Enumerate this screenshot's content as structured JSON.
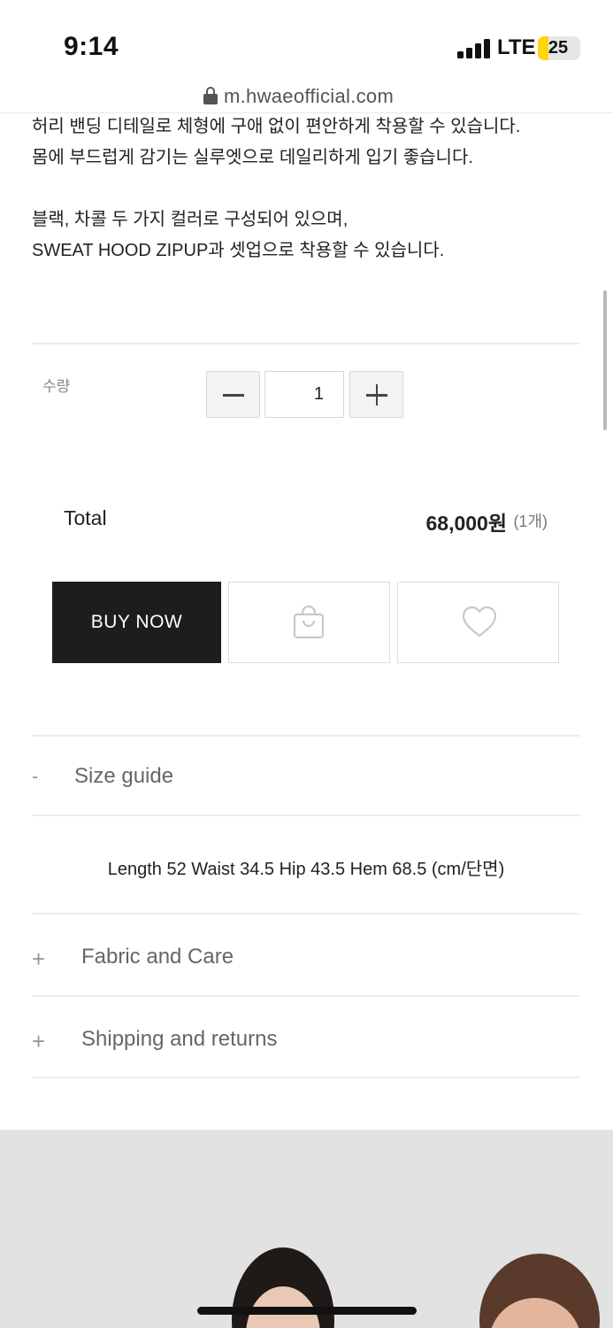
{
  "status_bar": {
    "time": "9:14",
    "network": "LTE",
    "battery": "25",
    "battery_level": 0.25
  },
  "browser": {
    "url": "m.hwaeofficial.com"
  },
  "description": {
    "line1": "허리 밴딩 디테일로 체형에 구애 없이 편안하게 착용할 수 있습니다.",
    "line2": "몸에 부드럽게 감기는 실루엣으로 데일리하게 입기 좋습니다.",
    "line3": "블랙, 차콜 두 가지 컬러로 구성되어 있으며,",
    "line4": "SWEAT HOOD ZIPUP과 셋업으로 착용할 수 있습니다."
  },
  "quantity": {
    "label": "수량",
    "value": "1"
  },
  "total": {
    "label": "Total",
    "price": "68,000원",
    "count": "(1개)"
  },
  "actions": {
    "buy_now": "BUY NOW",
    "cart_icon": "shopping-bag-icon",
    "wishlist_icon": "heart-icon"
  },
  "accordion": [
    {
      "sign": "-",
      "title": "Size guide",
      "content": "Length 52 Waist 34.5 Hip 43.5 Hem 68.5 (cm/단면)"
    },
    {
      "sign": "+",
      "title": "Fabric and Care"
    },
    {
      "sign": "+",
      "title": "Shipping and returns"
    }
  ],
  "colors": {
    "buy_now_bg": "#1d1d1d",
    "battery_fill": "#ffd60a"
  }
}
